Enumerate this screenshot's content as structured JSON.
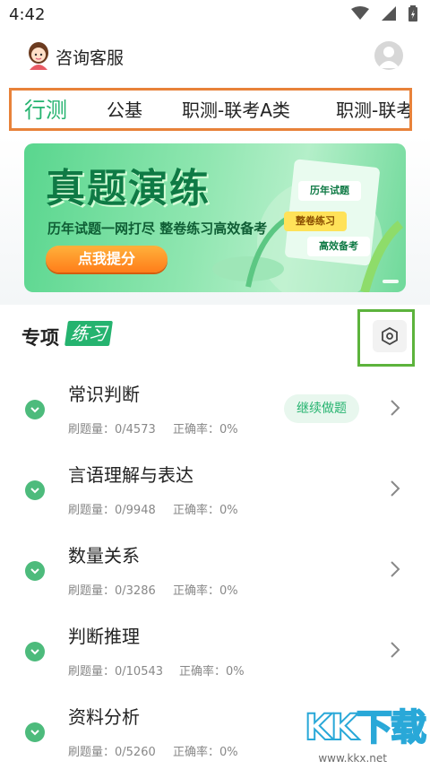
{
  "status_bar": {
    "time": "4:42",
    "icons": [
      "wifi-icon",
      "signal-icon",
      "battery-icon"
    ]
  },
  "header": {
    "service_label": "咨询客服"
  },
  "tabs": [
    {
      "label": "行测",
      "active": true
    },
    {
      "label": "公基",
      "active": false
    },
    {
      "label": "职测-联考A类",
      "active": false
    },
    {
      "label": "职测-联考",
      "active": false
    }
  ],
  "banner": {
    "title": "真题演练",
    "subtitle": "历年试题一网打尽  整卷练习高效备考",
    "button": "点我提分",
    "tags": [
      "历年试题",
      "整卷练习",
      "高效备考"
    ]
  },
  "section": {
    "title": "专项",
    "tag": "练习"
  },
  "labels": {
    "count_prefix": "刷题量：",
    "accuracy_prefix": "正确率：",
    "continue": "继续做题"
  },
  "practice_items": [
    {
      "name": "常识判断",
      "count": "刷题量：0/4573",
      "accuracy": "正确率：0%"
    },
    {
      "name": "言语理解与表达",
      "count": "刷题量：0/9948",
      "accuracy": "正确率：0%"
    },
    {
      "name": "数量关系",
      "count": "刷题量：0/3286",
      "accuracy": "正确率：0%"
    },
    {
      "name": "判断推理",
      "count": "刷题量：0/10543",
      "accuracy": "正确率：0%"
    },
    {
      "name": "资料分析",
      "count": "刷题量：0/5260",
      "accuracy": "正确率：0%"
    }
  ],
  "watermark": {
    "logo": "KK下载",
    "url": "www.kkx.net"
  },
  "colors": {
    "accent": "#25b36f",
    "tab_border": "#e8823a",
    "settings_border": "#5cb33c"
  }
}
